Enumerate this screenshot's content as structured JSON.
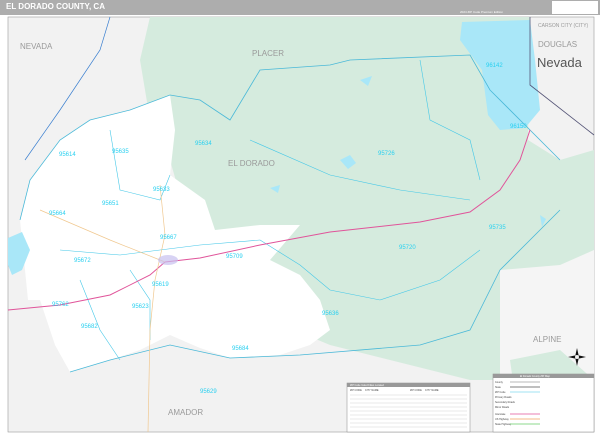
{
  "header": {
    "title": "EL DORADO COUNTY, CA",
    "edition": "2024 ZIP Code Premium Edition",
    "logo_text": "Map Sales"
  },
  "counties": {
    "nevada": "NEVADA",
    "placer": "PLACER",
    "el_dorado": "EL DORADO",
    "amador": "AMADOR",
    "alpine": "ALPINE",
    "douglas": "DOUGLAS",
    "carson": "CARSON CITY (CITY)",
    "state_nevada": "Nevada"
  },
  "zips": [
    "96142",
    "96150",
    "95726",
    "95735",
    "95720",
    "95634",
    "95635",
    "95614",
    "95633",
    "95651",
    "95664",
    "95667",
    "95672",
    "95709",
    "95619",
    "95762",
    "95623",
    "95682",
    "95636",
    "95684",
    "95629"
  ],
  "zip_table": {
    "title": "ZIP Code Index/Cities Located",
    "headers": [
      "ZIP CODE",
      "CITY NAME",
      "ZIP CODE",
      "CITY NAME"
    ]
  },
  "legend": {
    "title": "El Dorado County ZIP Map",
    "items": [
      "County",
      "State",
      "ZIP Code",
      "Primary Roads",
      "Secondary Roads",
      "Minor Roads",
      "Interstate",
      "US Highway",
      "State Highway"
    ]
  },
  "colors": {
    "forest": "#d5ebde",
    "water": "#a9e7f8",
    "land": "#f2f2f2",
    "zip_line": "#45c8e8",
    "interstate": "#e0549a",
    "road": "#f0c890"
  }
}
